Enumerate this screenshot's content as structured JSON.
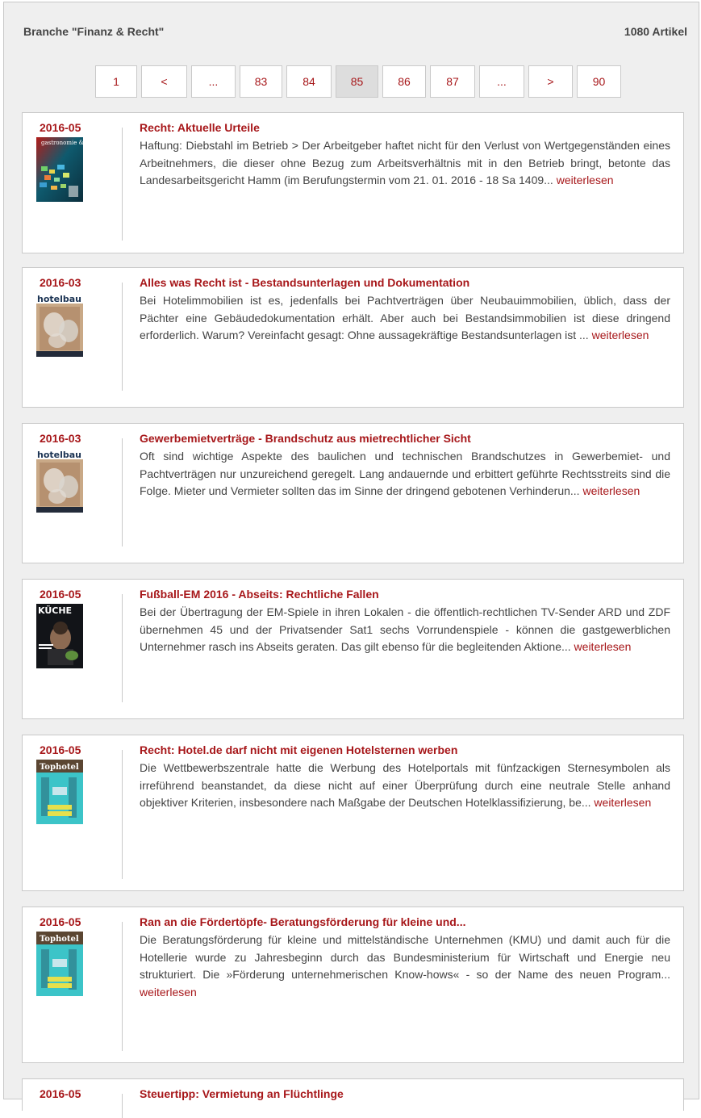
{
  "header": {
    "title": "Branche \"Finanz & Recht\"",
    "count": "1080 Artikel"
  },
  "pagination": {
    "pages": [
      "1",
      "<",
      "...",
      "83",
      "84",
      "85",
      "86",
      "87",
      "...",
      ">",
      "90"
    ],
    "active": "85"
  },
  "colors": {
    "accent": "#a7171a",
    "panel_bg": "#efefef",
    "border": "#c9c9c9",
    "text": "#444444"
  },
  "articles": [
    {
      "date": "2016-05",
      "magazine": "gastronomie & hotellerie",
      "title": "Recht: Aktuelle Urteile",
      "text": "Haftung: Diebstahl im Betrieb > Der Arbeitgeber haftet nicht für den Verlust von Wertgegenständen eines Arbeitnehmers, die dieser ohne Bezug zum Arbeitsverhältnis mit in den Betrieb bringt, betonte das Landesarbeitsgericht Hamm (im Berufungstermin vom 21. 01. 2016 - 18 Sa 1409...",
      "more": "weiterlesen"
    },
    {
      "date": "2016-03",
      "magazine": "hotelbau",
      "title": "Alles was Recht ist - Bestandsunterlagen und Dokumentation",
      "text": "Bei Hotelimmobilien ist es, jedenfalls bei Pachtverträgen über Neubauimmobilien, üblich, dass der Pächter eine Gebäudedokumentation erhält. Aber auch bei Bestandsimmobilien ist diese dringend erforderlich. Warum? Vereinfacht gesagt: Ohne aussagekräftige Bestandsunterlagen ist ...",
      "more": "weiterlesen"
    },
    {
      "date": "2016-03",
      "magazine": "hotelbau",
      "title": "Gewerbemietverträge - Brandschutz aus mietrechtlicher Sicht",
      "text": "Oft sind wichtige Aspekte des baulichen und technischen Brandschutzes in Gewerbemiet- und Pachtverträgen nur unzureichend geregelt. Lang andauernde und erbittert geführte Rechtsstreits sind die Folge. Mieter und Vermieter sollten das im Sinne der dringend gebotenen Verhinderun...",
      "more": "weiterlesen"
    },
    {
      "date": "2016-05",
      "magazine": "KÜCHE",
      "title": "Fußball-EM 2016 - Abseits: Rechtliche Fallen",
      "text": "Bei der Übertragung der EM-Spiele in ihren Lokalen - die öffentlich-rechtlichen TV-Sender ARD und ZDF übernehmen 45 und der Privatsender Sat1 sechs Vorrundenspiele - können die gastgewerblichen Unternehmer rasch ins Abseits geraten. Das gilt ebenso für die begleitenden Aktione...",
      "more": "weiterlesen"
    },
    {
      "date": "2016-05",
      "magazine": "Tophotel",
      "title": "Recht: Hotel.de darf nicht mit eigenen Hotelsternen werben",
      "text": "Die Wettbewerbszentrale hatte die Werbung des Hotelportals mit fünfzackigen Sternesymbolen als irreführend beanstandet, da diese nicht auf einer Überprüfung durch eine neutrale Stelle anhand objektiver Kriterien, insbesondere nach Maßgabe der Deutschen Hotelklassifizierung, be...",
      "more": "weiterlesen"
    },
    {
      "date": "2016-05",
      "magazine": "Tophotel",
      "title": "Ran an die Fördertöpfe- Beratungsförderung für kleine und...",
      "text": "Die Beratungsförderung für kleine und mittelständische Unternehmen (KMU) und damit auch für die Hotellerie wurde zu Jahresbeginn durch das Bundesministerium für Wirtschaft und Energie neu strukturiert. Die »Förderung unternehmerischen Know-hows« - so der Name des neuen Program...",
      "more": "weiterlesen"
    },
    {
      "date": "2016-05",
      "magazine": "",
      "title": "Steuertipp: Vermietung an Flüchtlinge",
      "text": "",
      "more": ""
    }
  ]
}
